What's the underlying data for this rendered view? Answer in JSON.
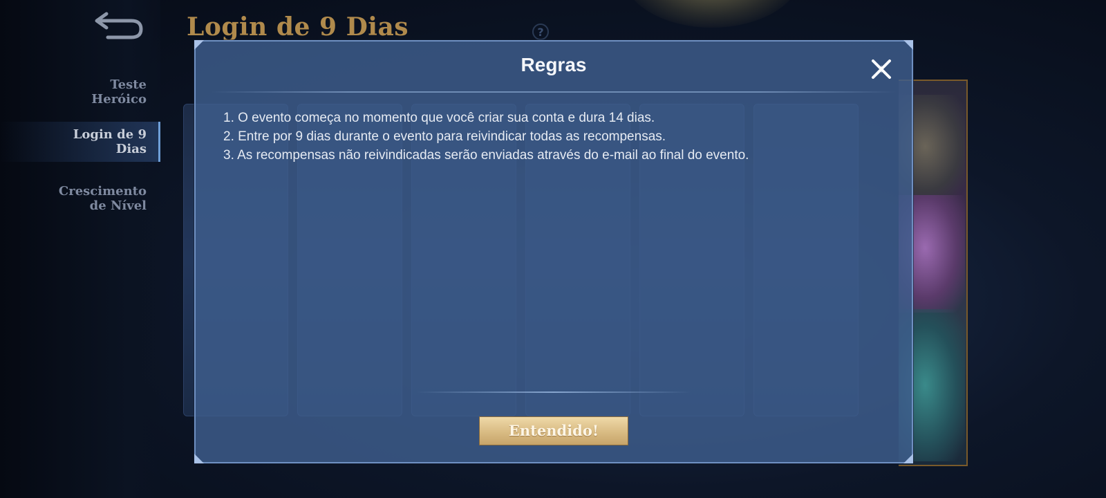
{
  "page": {
    "title": "Login de 9 Dias",
    "help_symbol": "?"
  },
  "sidebar": {
    "items": [
      {
        "label": "Teste\nHeróico",
        "active": false
      },
      {
        "label": "Login de 9\nDias",
        "active": true
      },
      {
        "label": "Crescimento\nde Nível",
        "active": false
      }
    ]
  },
  "modal": {
    "title": "Regras",
    "rules": [
      "1. O evento começa no momento que você criar sua conta e dura 14 dias.",
      "2. Entre por 9 dias durante o evento para reivindicar todas as recompensas.",
      "3. As recompensas não reivindicadas serão enviadas através do e-mail ao final do evento."
    ],
    "confirm_label": "Entendido!"
  },
  "icons": {
    "back": "back-arrow-icon",
    "close": "close-x-icon",
    "help": "help-icon"
  },
  "colors": {
    "title_gold": "#b08a4c",
    "modal_bg": "#3e5e8e",
    "button_gold": "#d9bb83"
  }
}
